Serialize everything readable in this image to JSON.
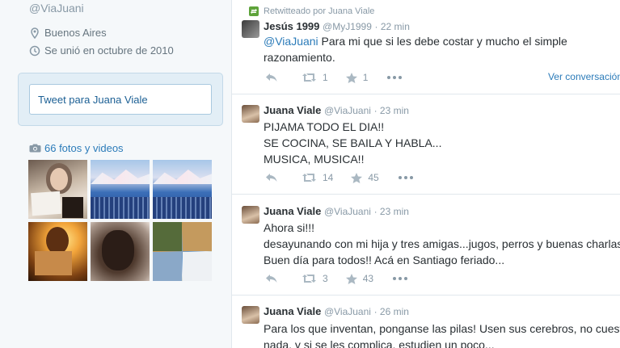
{
  "profile": {
    "handle": "@ViaJuani",
    "location": "Buenos Aires",
    "joined": "Se unió en octubre de 2010",
    "tweet_box_label": "Tweet para Juana Viale",
    "photos_label": "66 fotos y videos"
  },
  "tweets": [
    {
      "retweet_label": "Retwitteado por Juana Viale",
      "name": "Jesús 1999",
      "screen_name": "@MyJ1999",
      "time": "22 min",
      "mention": "@ViaJuani",
      "text_after_mention": " Para mi que si les debe costar y mucho el simple",
      "text_line2": "razonamiento.",
      "retweets": "1",
      "favorites": "1",
      "conversation_link": "Ver conversación"
    },
    {
      "name": "Juana Viale",
      "screen_name": "@ViaJuani",
      "time": "23 min",
      "text": "PIJAMA TODO EL DIA!!\nSE COCINA, SE BAILA Y HABLA...\nMUSICA, MUSICA!!",
      "retweets": "14",
      "favorites": "45"
    },
    {
      "name": "Juana Viale",
      "screen_name": "@ViaJuani",
      "time": "23 min",
      "text": "Ahora si!!!\ndesayunando con mi hija y tres amigas...jugos, perros y buenas charlas\nBuen día para todos!! Acá en Santiago feriado...",
      "retweets": "3",
      "favorites": "43"
    },
    {
      "name": "Juana Viale",
      "screen_name": "@ViaJuani",
      "time": "26 min",
      "text": "Para los que inventan, ponganse las pilas! Usen sus cerebros, no cuesta\nnada, y si se les complica, estudien un poco..."
    }
  ],
  "colors": {
    "link": "#2b7bb9",
    "muted": "#8899a6",
    "retweet_green": "#5ea33a"
  }
}
